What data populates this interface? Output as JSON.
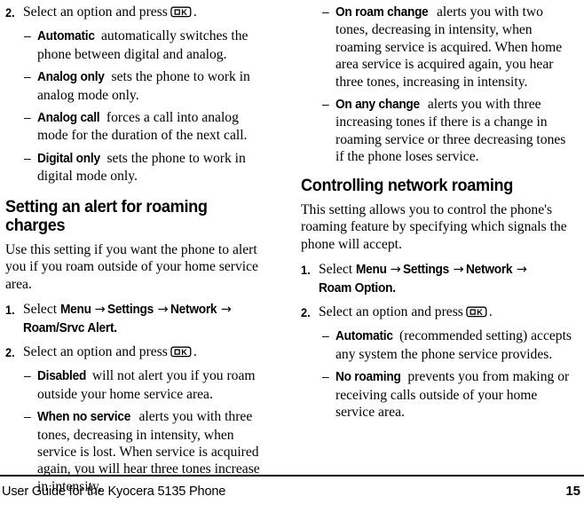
{
  "document": {
    "title": "User Guide for the Kyocera 5135 Phone",
    "page_number": "15"
  },
  "icons": {
    "ok_key": "ok-key-icon",
    "ok_key_label": "K"
  },
  "left_column": {
    "step2": {
      "number": "2.",
      "text_before_icon": "Select an option and press",
      "text_after_icon": "."
    },
    "mode_options": [
      {
        "dash": "–",
        "label": "Automatic",
        "text": " automatically switches the phone between digital and analog."
      },
      {
        "dash": "–",
        "label": "Analog only",
        "text": " sets the phone to work in analog mode only."
      },
      {
        "dash": "–",
        "label": "Analog call",
        "text": " forces a call into analog mode for the duration of the next call."
      },
      {
        "dash": "–",
        "label": "Digital only",
        "text": " sets the phone to work in digital mode only."
      }
    ],
    "heading": "Setting an alert for roaming charges",
    "intro": "Use this setting if you want the phone to alert you if you roam outside of your home service area.",
    "step1": {
      "number": "1.",
      "select_label": "Select",
      "path": [
        "Menu",
        "Settings",
        "Network",
        "Roam/Srvc Alert."
      ],
      "arrow": "→"
    },
    "step2b": {
      "number": "2.",
      "text_before_icon": "Select an option and press",
      "text_after_icon": "."
    },
    "alert_options": [
      {
        "dash": "–",
        "label": "Disabled",
        "text": " will not alert you if you roam outside your home service area."
      },
      {
        "dash": "–",
        "label": "When no service",
        "text": " alerts you with three tones, decreasing in intensity, when service is lost. When service is acquired again, you will hear three tones increase in intensity."
      }
    ]
  },
  "right_column": {
    "alert_options_continued": [
      {
        "dash": "–",
        "label": "On roam change",
        "text": " alerts you with two tones, decreasing in intensity, when roaming service is acquired. When home area service is acquired again, you hear three tones, increasing in intensity."
      },
      {
        "dash": "–",
        "label": "On any change",
        "text": " alerts you with three increasing tones if there is a change in roaming service or three decreasing tones if the phone loses service."
      }
    ],
    "heading": "Controlling network roaming",
    "intro": "This setting allows you to control the phone's roaming feature by specifying which signals the phone will accept.",
    "step1": {
      "number": "1.",
      "select_label": "Select",
      "path": [
        "Menu",
        "Settings",
        "Network",
        "Roam Option."
      ],
      "arrow": "→"
    },
    "step2": {
      "number": "2.",
      "text_before_icon": "Select an option and press",
      "text_after_icon": "."
    },
    "roam_options": [
      {
        "dash": "–",
        "label": "Automatic",
        "text": " (recommended setting) accepts any system the phone service provides."
      },
      {
        "dash": "–",
        "label": "No roaming",
        "text": " prevents you from making or receiving calls outside of your home service area."
      }
    ]
  },
  "colors": {
    "text": "#000000",
    "background": "#ffffff"
  }
}
